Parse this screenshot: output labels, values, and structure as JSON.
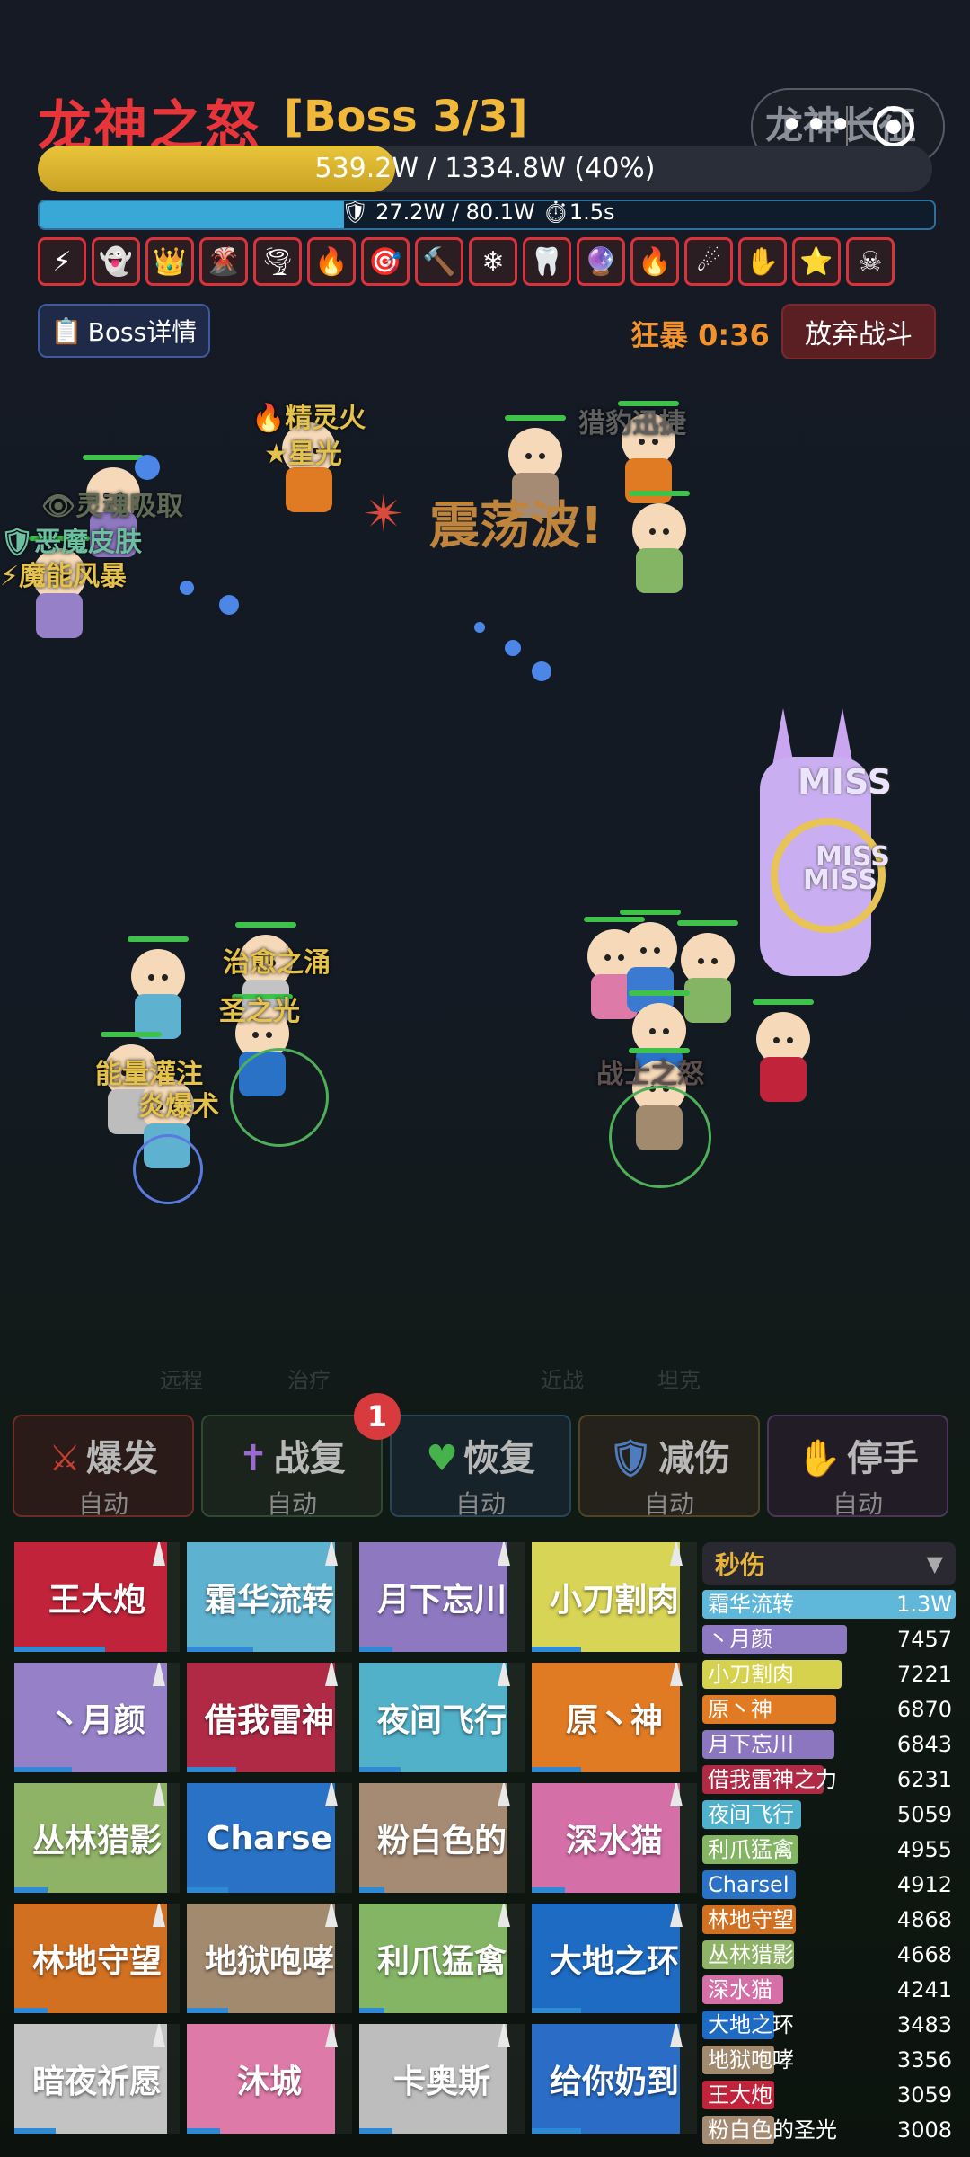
{
  "header": {
    "title": "龙神之怒",
    "boss_tag": "[Boss 3/3]",
    "capsule_watermark": "龙神长征",
    "capsule_more": "•••",
    "hp_text": "539.2W / 1334.8W (40%)",
    "hp_percent": 40,
    "shield_text": "🛡 27.2W / 80.1W  ⏱1.5s",
    "shield_percent": 34,
    "buffs": [
      "⚡",
      "👻",
      "👑",
      "🌋",
      "🌪",
      "🔥",
      "🎯",
      "🔨",
      "❄",
      "🦷",
      "🔮",
      "🔥",
      "☄",
      "✋",
      "⭐",
      "☠"
    ],
    "boss_detail_icon": "📋",
    "boss_detail_label": "Boss详情",
    "rage_label": "狂暴 0:36",
    "giveup_label": "放弃战斗"
  },
  "battlefield": {
    "float_texts": [
      "🔥精灵火",
      "★星光",
      "👁灵魂吸取",
      "🛡恶魔皮肤",
      "⚡魔能风暴",
      "猎豹迅捷",
      "治愈之涌",
      "圣之光",
      "能量灌注",
      "炎爆术",
      "战士之怒"
    ],
    "big_text": "震荡波!",
    "big_text_icon": "✴",
    "miss_texts": [
      "MISS",
      "MISS",
      "MISS"
    ],
    "zones": [
      "远程",
      "治疗",
      "近战",
      "坦克"
    ]
  },
  "skills": {
    "badge": "1",
    "items": [
      {
        "icon": "⚔",
        "name": "爆发",
        "auto": "自动",
        "color": "#c8402f",
        "bg": "#2a1a18",
        "border": "#6a2e26"
      },
      {
        "icon": "✝",
        "name": "战复",
        "auto": "自动",
        "color": "#9a6ad0",
        "bg": "#1a241c",
        "border": "#2f4a33"
      },
      {
        "icon": "♥",
        "name": "恢复",
        "auto": "自动",
        "color": "#45b24c",
        "bg": "#17232a",
        "border": "#2a4656"
      },
      {
        "icon": "🛡",
        "name": "减伤",
        "auto": "自动",
        "color": "#4f7bbf",
        "bg": "#24221a",
        "border": "#4e4526"
      },
      {
        "icon": "✋",
        "name": "停手",
        "auto": "自动",
        "color": "#e6a83b",
        "bg": "#221c26",
        "border": "#4a3658"
      }
    ]
  },
  "players": [
    {
      "name": "王大炮",
      "color": "#c1243a",
      "progress": 0.55
    },
    {
      "name": "霜华流转",
      "color": "#5fb1d0",
      "progress": 0.4
    },
    {
      "name": "月下忘川",
      "color": "#8e78c0",
      "progress": 0.2
    },
    {
      "name": "小刀割肉",
      "color": "#d8d456",
      "progress": 0.3
    },
    {
      "name": "丶月颜",
      "color": "#9681c9",
      "progress": 0.35
    },
    {
      "name": "借我雷神",
      "color": "#b02a45",
      "progress": 0.3
    },
    {
      "name": "夜间飞行",
      "color": "#51b1c9",
      "progress": 0.25
    },
    {
      "name": "原丶神",
      "color": "#e07b24",
      "progress": 0.3
    },
    {
      "name": "丛林猎影",
      "color": "#8fb366",
      "progress": 0.2
    },
    {
      "name": "Charse",
      "color": "#2a72c6",
      "progress": 0.25
    },
    {
      "name": "粉白色的",
      "color": "#a58b74",
      "progress": 0.15
    },
    {
      "name": "深水猫",
      "color": "#d56fa8",
      "progress": 0.2
    },
    {
      "name": "林地守望",
      "color": "#d27021",
      "progress": 0.2
    },
    {
      "name": "地狱咆哮",
      "color": "#a28a6f",
      "progress": 0.25
    },
    {
      "name": "利爪猛禽",
      "color": "#84b565",
      "progress": 0.15
    },
    {
      "name": "大地之环",
      "color": "#1e6bc3",
      "progress": 0.3
    },
    {
      "name": "暗夜祈愿",
      "color": "#c3c3c3",
      "progress": 0.25
    },
    {
      "name": "沐城",
      "color": "#dd7aa8",
      "progress": 0.2
    },
    {
      "name": "卡奥斯",
      "color": "#bdbdbd",
      "progress": 0.2
    },
    {
      "name": "给你奶到",
      "color": "#2a6cc6",
      "progress": 0.3
    }
  ],
  "damage_panel": {
    "title": "秒伤",
    "caret": "▼",
    "rows": [
      {
        "name": "霜华流转",
        "value": "1.3W",
        "color": "#5fb8da",
        "ratio": 1.0
      },
      {
        "name": "丶月颜",
        "value": "7457",
        "color": "#8d78c2",
        "ratio": 0.57
      },
      {
        "name": "小刀割肉",
        "value": "7221",
        "color": "#d6d24d",
        "ratio": 0.55
      },
      {
        "name": "原丶神",
        "value": "6870",
        "color": "#e07b24",
        "ratio": 0.53
      },
      {
        "name": "月下忘川",
        "value": "6843",
        "color": "#8c76bf",
        "ratio": 0.52
      },
      {
        "name": "借我雷神之力",
        "value": "6231",
        "color": "#b02a45",
        "ratio": 0.48
      },
      {
        "name": "夜间飞行",
        "value": "5059",
        "color": "#4fb0cb",
        "ratio": 0.39
      },
      {
        "name": "利爪猛禽",
        "value": "4955",
        "color": "#84b565",
        "ratio": 0.38
      },
      {
        "name": "Charsel",
        "value": "4912",
        "color": "#2a72c6",
        "ratio": 0.37
      },
      {
        "name": "林地守望",
        "value": "4868",
        "color": "#d27021",
        "ratio": 0.37
      },
      {
        "name": "丛林猎影",
        "value": "4668",
        "color": "#8fb366",
        "ratio": 0.36
      },
      {
        "name": "深水猫",
        "value": "4241",
        "color": "#d56fa8",
        "ratio": 0.32
      },
      {
        "name": "大地之环",
        "value": "3483",
        "color": "#1e6bc3",
        "ratio": 0.27
      },
      {
        "name": "地狱咆哮",
        "value": "3356",
        "color": "#a28a6f",
        "ratio": 0.26
      },
      {
        "name": "王大炮",
        "value": "3059",
        "color": "#c1243a",
        "ratio": 0.23
      },
      {
        "name": "粉白色的圣光",
        "value": "3008",
        "color": "#a58b74",
        "ratio": 0.23
      }
    ]
  }
}
